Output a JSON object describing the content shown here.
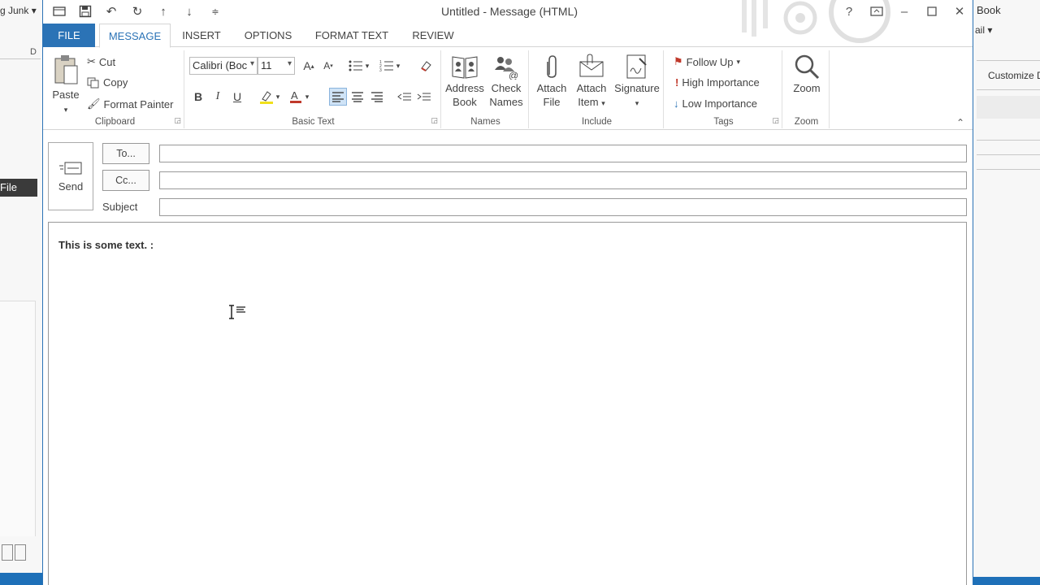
{
  "background": {
    "left": {
      "junk_label": "g Junk",
      "d_letter": "D",
      "selected_label": "File"
    },
    "right": {
      "book_label": "Book",
      "mail_label": "ail",
      "customize_label": "Customize D"
    }
  },
  "window": {
    "title": "Untitled - Message (HTML)"
  },
  "tabs": [
    {
      "label": "FILE"
    },
    {
      "label": "MESSAGE"
    },
    {
      "label": "INSERT"
    },
    {
      "label": "OPTIONS"
    },
    {
      "label": "FORMAT TEXT"
    },
    {
      "label": "REVIEW"
    }
  ],
  "ribbon": {
    "clipboard": {
      "label": "Clipboard",
      "paste": "Paste",
      "cut": "Cut",
      "copy": "Copy",
      "format_painter": "Format Painter"
    },
    "basic_text": {
      "label": "Basic Text",
      "font": "Calibri (Boc",
      "size": "11",
      "bold": "B",
      "italic": "I",
      "underline": "U"
    },
    "names": {
      "label": "Names",
      "address_book_1": "Address",
      "address_book_2": "Book",
      "check_names_1": "Check",
      "check_names_2": "Names"
    },
    "include": {
      "label": "Include",
      "attach_file_1": "Attach",
      "attach_file_2": "File",
      "attach_item_1": "Attach",
      "attach_item_2": "Item",
      "signature": "Signature"
    },
    "tags": {
      "label": "Tags",
      "follow_up": "Follow Up",
      "high_importance": "High Importance",
      "low_importance": "Low Importance"
    },
    "zoom": {
      "label": "Zoom",
      "zoom": "Zoom"
    }
  },
  "header": {
    "send": "Send",
    "to": "To...",
    "cc": "Cc...",
    "subject": "Subject"
  },
  "body": {
    "text": "This is some text. :"
  }
}
